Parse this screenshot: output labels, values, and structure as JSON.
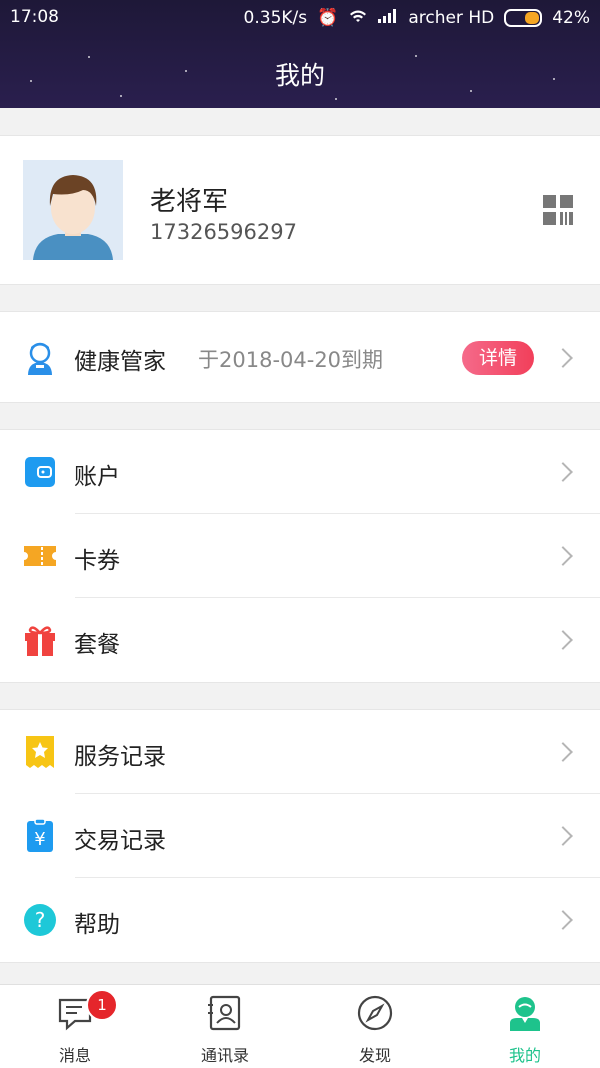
{
  "status_bar": {
    "time": "17:08",
    "speed": "0.35K/s",
    "carrier": "archer HD",
    "battery": "42%"
  },
  "header": {
    "title": "我的"
  },
  "profile": {
    "name": "老将军",
    "phone": "17326596297",
    "qr_icon": "qr-code-icon"
  },
  "health": {
    "label": "健康管家",
    "expiry": "于2018-04-20到期",
    "detail_label": "详情"
  },
  "menu_group1": [
    {
      "label": "账户",
      "icon": "wallet-icon",
      "color": "#1e9bf0"
    },
    {
      "label": "卡券",
      "icon": "ticket-icon",
      "color": "#f5a623"
    },
    {
      "label": "套餐",
      "icon": "gift-icon",
      "color": "#f0433f"
    }
  ],
  "menu_group2": [
    {
      "label": "服务记录",
      "icon": "star-receipt-icon",
      "color": "#f7c515"
    },
    {
      "label": "交易记录",
      "icon": "yen-receipt-icon",
      "color": "#1e9bf0"
    },
    {
      "label": "帮助",
      "icon": "help-icon",
      "color": "#1ec8d8"
    }
  ],
  "tabs": [
    {
      "label": "消息",
      "icon": "message-icon",
      "badge": "1"
    },
    {
      "label": "通讯录",
      "icon": "contacts-icon"
    },
    {
      "label": "发现",
      "icon": "compass-icon"
    },
    {
      "label": "我的",
      "icon": "profile-icon",
      "active": true
    }
  ],
  "colors": {
    "accent": "#1ec38c",
    "header_bg": "#231a42",
    "badge": "#e5262b"
  }
}
